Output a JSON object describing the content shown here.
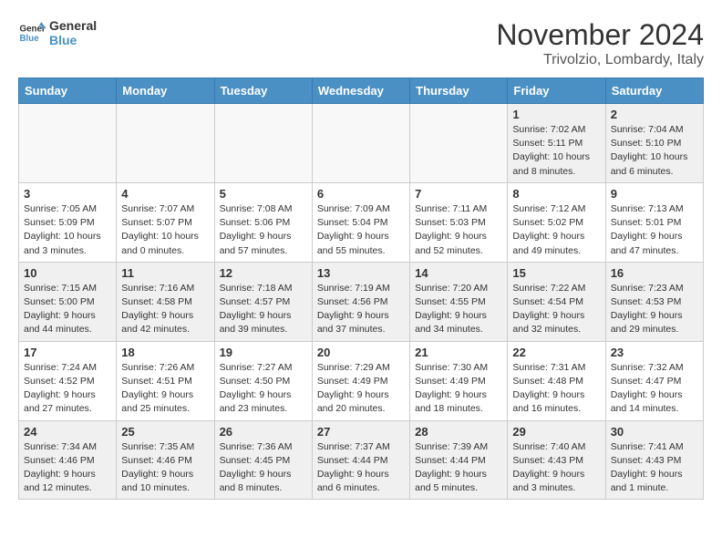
{
  "logo": {
    "line1": "General",
    "line2": "Blue"
  },
  "title": "November 2024",
  "location": "Trivolzio, Lombardy, Italy",
  "headers": [
    "Sunday",
    "Monday",
    "Tuesday",
    "Wednesday",
    "Thursday",
    "Friday",
    "Saturday"
  ],
  "weeks": [
    [
      {
        "day": "",
        "info": ""
      },
      {
        "day": "",
        "info": ""
      },
      {
        "day": "",
        "info": ""
      },
      {
        "day": "",
        "info": ""
      },
      {
        "day": "",
        "info": ""
      },
      {
        "day": "1",
        "info": "Sunrise: 7:02 AM\nSunset: 5:11 PM\nDaylight: 10 hours\nand 8 minutes."
      },
      {
        "day": "2",
        "info": "Sunrise: 7:04 AM\nSunset: 5:10 PM\nDaylight: 10 hours\nand 6 minutes."
      }
    ],
    [
      {
        "day": "3",
        "info": "Sunrise: 7:05 AM\nSunset: 5:09 PM\nDaylight: 10 hours\nand 3 minutes."
      },
      {
        "day": "4",
        "info": "Sunrise: 7:07 AM\nSunset: 5:07 PM\nDaylight: 10 hours\nand 0 minutes."
      },
      {
        "day": "5",
        "info": "Sunrise: 7:08 AM\nSunset: 5:06 PM\nDaylight: 9 hours\nand 57 minutes."
      },
      {
        "day": "6",
        "info": "Sunrise: 7:09 AM\nSunset: 5:04 PM\nDaylight: 9 hours\nand 55 minutes."
      },
      {
        "day": "7",
        "info": "Sunrise: 7:11 AM\nSunset: 5:03 PM\nDaylight: 9 hours\nand 52 minutes."
      },
      {
        "day": "8",
        "info": "Sunrise: 7:12 AM\nSunset: 5:02 PM\nDaylight: 9 hours\nand 49 minutes."
      },
      {
        "day": "9",
        "info": "Sunrise: 7:13 AM\nSunset: 5:01 PM\nDaylight: 9 hours\nand 47 minutes."
      }
    ],
    [
      {
        "day": "10",
        "info": "Sunrise: 7:15 AM\nSunset: 5:00 PM\nDaylight: 9 hours\nand 44 minutes."
      },
      {
        "day": "11",
        "info": "Sunrise: 7:16 AM\nSunset: 4:58 PM\nDaylight: 9 hours\nand 42 minutes."
      },
      {
        "day": "12",
        "info": "Sunrise: 7:18 AM\nSunset: 4:57 PM\nDaylight: 9 hours\nand 39 minutes."
      },
      {
        "day": "13",
        "info": "Sunrise: 7:19 AM\nSunset: 4:56 PM\nDaylight: 9 hours\nand 37 minutes."
      },
      {
        "day": "14",
        "info": "Sunrise: 7:20 AM\nSunset: 4:55 PM\nDaylight: 9 hours\nand 34 minutes."
      },
      {
        "day": "15",
        "info": "Sunrise: 7:22 AM\nSunset: 4:54 PM\nDaylight: 9 hours\nand 32 minutes."
      },
      {
        "day": "16",
        "info": "Sunrise: 7:23 AM\nSunset: 4:53 PM\nDaylight: 9 hours\nand 29 minutes."
      }
    ],
    [
      {
        "day": "17",
        "info": "Sunrise: 7:24 AM\nSunset: 4:52 PM\nDaylight: 9 hours\nand 27 minutes."
      },
      {
        "day": "18",
        "info": "Sunrise: 7:26 AM\nSunset: 4:51 PM\nDaylight: 9 hours\nand 25 minutes."
      },
      {
        "day": "19",
        "info": "Sunrise: 7:27 AM\nSunset: 4:50 PM\nDaylight: 9 hours\nand 23 minutes."
      },
      {
        "day": "20",
        "info": "Sunrise: 7:29 AM\nSunset: 4:49 PM\nDaylight: 9 hours\nand 20 minutes."
      },
      {
        "day": "21",
        "info": "Sunrise: 7:30 AM\nSunset: 4:49 PM\nDaylight: 9 hours\nand 18 minutes."
      },
      {
        "day": "22",
        "info": "Sunrise: 7:31 AM\nSunset: 4:48 PM\nDaylight: 9 hours\nand 16 minutes."
      },
      {
        "day": "23",
        "info": "Sunrise: 7:32 AM\nSunset: 4:47 PM\nDaylight: 9 hours\nand 14 minutes."
      }
    ],
    [
      {
        "day": "24",
        "info": "Sunrise: 7:34 AM\nSunset: 4:46 PM\nDaylight: 9 hours\nand 12 minutes."
      },
      {
        "day": "25",
        "info": "Sunrise: 7:35 AM\nSunset: 4:46 PM\nDaylight: 9 hours\nand 10 minutes."
      },
      {
        "day": "26",
        "info": "Sunrise: 7:36 AM\nSunset: 4:45 PM\nDaylight: 9 hours\nand 8 minutes."
      },
      {
        "day": "27",
        "info": "Sunrise: 7:37 AM\nSunset: 4:44 PM\nDaylight: 9 hours\nand 6 minutes."
      },
      {
        "day": "28",
        "info": "Sunrise: 7:39 AM\nSunset: 4:44 PM\nDaylight: 9 hours\nand 5 minutes."
      },
      {
        "day": "29",
        "info": "Sunrise: 7:40 AM\nSunset: 4:43 PM\nDaylight: 9 hours\nand 3 minutes."
      },
      {
        "day": "30",
        "info": "Sunrise: 7:41 AM\nSunset: 4:43 PM\nDaylight: 9 hours\nand 1 minute."
      }
    ]
  ]
}
